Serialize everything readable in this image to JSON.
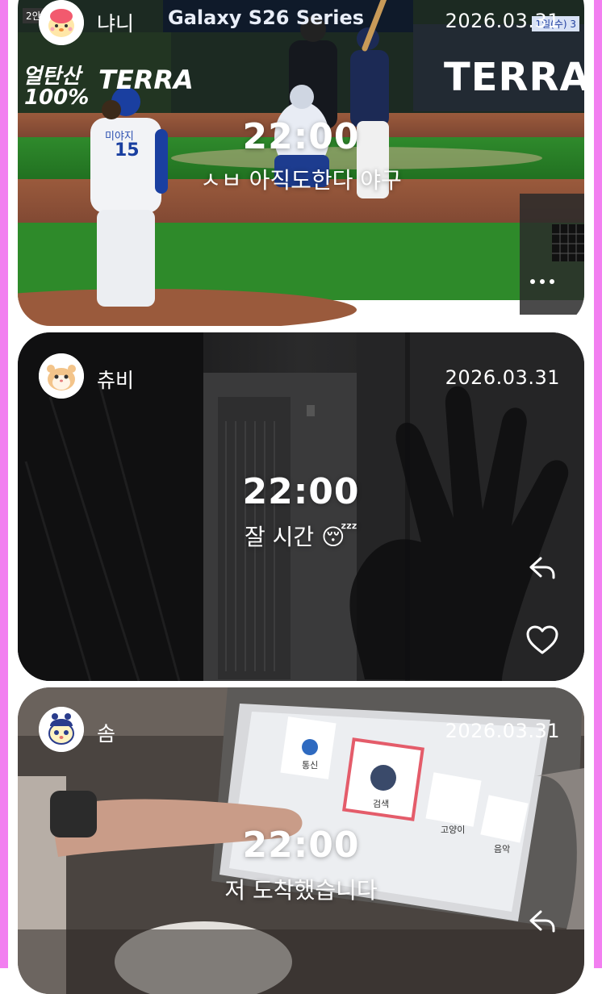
{
  "posts": [
    {
      "username": "냐니",
      "date": "2026.03.31",
      "time": "22:00",
      "caption": "ㅅㅂ 아직도한다 야구",
      "scoreboard": {
        "sponsor_left_1": "얼탄산",
        "sponsor_left_2": "100%",
        "brand_left": "TERRA",
        "banner_title": "Galaxy S26 Series",
        "brand_right": "TERRA",
        "inning": "2안타",
        "corner": "1일(수) 3"
      },
      "pitcher_name": "미야지",
      "pitcher_number": "15",
      "avatar_icon": "chick-character-icon",
      "more_icon": "more-dots-icon"
    },
    {
      "username": "츄비",
      "date": "2026.03.31",
      "time": "22:00",
      "caption": "잘 시간",
      "emoji": "😴",
      "avatar_icon": "hamster-character-icon",
      "reply_icon": "reply-arrow-icon",
      "like_icon": "heart-outline-icon"
    },
    {
      "username": "솜",
      "date": "2026.03.31",
      "time": "22:00",
      "caption": "저 도착했습니다",
      "screen_labels": [
        "통신",
        "검색",
        "고양이",
        "음악"
      ],
      "avatar_icon": "tamagotchi-character-icon",
      "reply_icon": "reply-arrow-icon"
    }
  ],
  "colors": {
    "frame_edge": "#f27ff0",
    "text_on_photo": "#ffffff",
    "background": "#ffffff"
  }
}
